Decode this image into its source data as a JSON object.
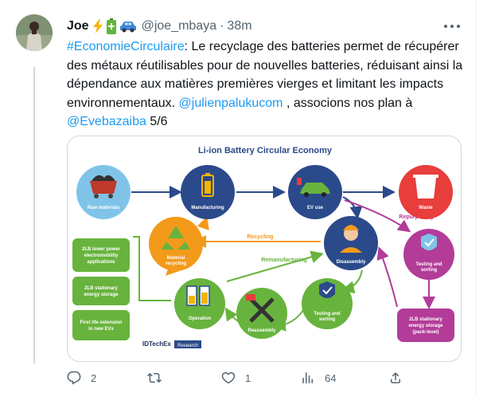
{
  "tweet": {
    "author": {
      "name": "Joe",
      "handle": "@joe_mbaya",
      "separator": "·",
      "timestamp": "38m"
    },
    "text": {
      "hashtag": "#EconomieCirculaire",
      "body": ": Le recyclage des batteries permet de récupérer des métaux réutilisables pour de nouvelles batteries, réduisant ainsi la dépendance aux matières premières vierges et limitant les impacts environnementaux. ",
      "mention1": "@julienpalukucom",
      "middle": " , associons nos plan à ",
      "mention2": "@Evebazaiba",
      "end": " 5/6"
    },
    "infographic": {
      "title": "Li-ion Battery Circular Economy",
      "nodes": {
        "raw": "Raw materials",
        "manufacturing": "Manufacturing",
        "ev": "EV use",
        "waste": "Waste",
        "material1": "Material",
        "material2": "recycling",
        "disassembly": "Disassembly",
        "testing_right1": "Testing and",
        "testing_right2": "sorting",
        "testing_bottom1": "Testing and",
        "testing_bottom2": "sorting",
        "operation": "Operation",
        "reassembly": "Reassembly",
        "stationary_pack1": "2LB stationary",
        "stationary_pack2": "energy storage",
        "stationary_pack3": "(pack-level)"
      },
      "flow_labels": {
        "recycling": "Recycling",
        "remanufacturing": "Remanufacturing",
        "repurposing": "Repurposing"
      },
      "applications": [
        [
          "2LB lower power",
          "electromobility",
          "applications"
        ],
        [
          "2LB stationary",
          "energy storage"
        ],
        [
          "First life extension",
          "in new EVs"
        ]
      ],
      "brand": "IDTechEx",
      "brand_sub": "Research"
    },
    "actions": {
      "replies": "2",
      "retweets": "",
      "likes": "1",
      "views": "64"
    }
  },
  "colors": {
    "link": "#1d9bf0",
    "text": "#0f1419",
    "muted": "#536471",
    "navy": "#2b4a8b",
    "green": "#68b33d",
    "orange": "#f39a1b",
    "red": "#e83e3c",
    "purple": "#b23c98",
    "light_blue": "#7fc4e8"
  }
}
